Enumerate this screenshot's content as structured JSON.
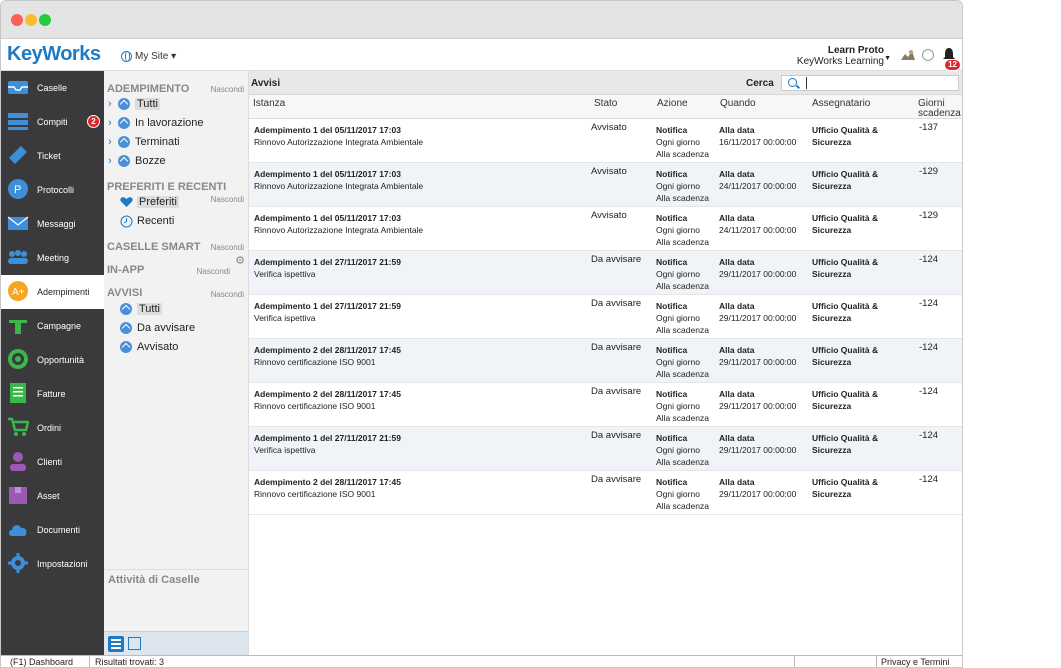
{
  "header": {
    "logo": "KeyWorks",
    "site_label": "My Site ▾",
    "user_name": "Learn Proto",
    "user_org": "KeyWorks Learning",
    "notifications_count": "12"
  },
  "sidebar": {
    "items": [
      {
        "label": "Caselle",
        "icon": "inbox-icon",
        "color": "#3c8fd8"
      },
      {
        "label": "Compiti",
        "icon": "tasks-icon",
        "color": "#3c8fd8",
        "badge": "2"
      },
      {
        "label": "Ticket",
        "icon": "ticket-icon",
        "color": "#3c8fd8"
      },
      {
        "label": "Protocolli",
        "icon": "protocol-icon",
        "color": "#3c8fd8"
      },
      {
        "label": "Messaggi",
        "icon": "envelope-icon",
        "color": "#3c8fd8"
      },
      {
        "label": "Meeting",
        "icon": "people-icon",
        "color": "#3c8fd8"
      },
      {
        "label": "Adempimenti",
        "icon": "compliance-icon",
        "color": "#f5a623"
      },
      {
        "label": "Campagne",
        "icon": "campaign-icon",
        "color": "#3cb54a"
      },
      {
        "label": "Opportunità",
        "icon": "target-icon",
        "color": "#3cb54a"
      },
      {
        "label": "Fatture",
        "icon": "invoice-icon",
        "color": "#3cb54a"
      },
      {
        "label": "Ordini",
        "icon": "cart-icon",
        "color": "#3cb54a"
      },
      {
        "label": "Clienti",
        "icon": "person-icon",
        "color": "#9b59b6"
      },
      {
        "label": "Asset",
        "icon": "box-icon",
        "color": "#9b59b6"
      },
      {
        "label": "Documenti",
        "icon": "cloud-icon",
        "color": "#3c8fd8"
      },
      {
        "label": "Impostazioni",
        "icon": "gear-icon",
        "color": "#3c8fd8"
      }
    ]
  },
  "panel": {
    "hide_label": "Nascondi",
    "sec_adempimento": "ADEMPIMENTO",
    "adempimento_items": [
      "Tutti",
      "In lavorazione",
      "Terminati",
      "Bozze"
    ],
    "sec_preferiti": "PREFERITI E RECENTI",
    "preferiti_items": [
      "Preferiti",
      "Recenti"
    ],
    "sec_caselle_smart": "CASELLE SMART",
    "sec_inapp": "IN-APP",
    "sec_avvisi": "AVVISI",
    "avvisi_items": [
      "Tutti",
      "Da avvisare",
      "Avvisato"
    ],
    "footer_title": "Attività di Caselle"
  },
  "main": {
    "title": "Avvisi",
    "search_label": "Cerca",
    "search_value": "",
    "columns": {
      "istanza": "Istanza",
      "stato": "Stato",
      "azione": "Azione",
      "quando": "Quando",
      "assegnatario": "Assegnatario",
      "giorni": "Giorni scadenza"
    },
    "rows": [
      {
        "title": "Adempimento 1 del 05/11/2017 17:03",
        "desc": "Rinnovo Autorizzazione Integrata Ambientale",
        "stato": "Avvisato",
        "azione1": "Notifica",
        "azione2": "Ogni giorno",
        "azione3": "Alla scadenza",
        "quando1": "Alla data",
        "quando2": "16/11/2017 00:00:00",
        "ass": "Ufficio Qualità & Sicurezza",
        "giorni": "-137"
      },
      {
        "title": "Adempimento 1 del 05/11/2017 17:03",
        "desc": "Rinnovo Autorizzazione Integrata Ambientale",
        "stato": "Avvisato",
        "azione1": "Notifica",
        "azione2": "Ogni giorno",
        "azione3": "Alla scadenza",
        "quando1": "Alla data",
        "quando2": "24/11/2017 00:00:00",
        "ass": "Ufficio Qualità & Sicurezza",
        "giorni": "-129"
      },
      {
        "title": "Adempimento 1 del 05/11/2017 17:03",
        "desc": "Rinnovo Autorizzazione Integrata Ambientale",
        "stato": "Avvisato",
        "azione1": "Notifica",
        "azione2": "Ogni giorno",
        "azione3": "Alla scadenza",
        "quando1": "Alla data",
        "quando2": "24/11/2017 00:00:00",
        "ass": "Ufficio Qualità & Sicurezza",
        "giorni": "-129"
      },
      {
        "title": "Adempimento 1 del 27/11/2017 21:59",
        "desc": "Verifica ispettiva",
        "stato": "Da avvisare",
        "azione1": "Notifica",
        "azione2": "Ogni giorno",
        "azione3": "Alla scadenza",
        "quando1": "Alla data",
        "quando2": "29/11/2017 00:00:00",
        "ass": "Ufficio Qualità & Sicurezza",
        "giorni": "-124"
      },
      {
        "title": "Adempimento 1 del 27/11/2017 21:59",
        "desc": "Verifica ispettiva",
        "stato": "Da avvisare",
        "azione1": "Notifica",
        "azione2": "Ogni giorno",
        "azione3": "Alla scadenza",
        "quando1": "Alla data",
        "quando2": "29/11/2017 00:00:00",
        "ass": "Ufficio Qualità & Sicurezza",
        "giorni": "-124"
      },
      {
        "title": "Adempimento 2 del 28/11/2017 17:45",
        "desc": "Rinnovo certificazione ISO 9001",
        "stato": "Da avvisare",
        "azione1": "Notifica",
        "azione2": "Ogni giorno",
        "azione3": "Alla scadenza",
        "quando1": "Alla data",
        "quando2": "29/11/2017 00:00:00",
        "ass": "Ufficio Qualità & Sicurezza",
        "giorni": "-124"
      },
      {
        "title": "Adempimento 2 del 28/11/2017 17:45",
        "desc": "Rinnovo certificazione ISO 9001",
        "stato": "Da avvisare",
        "azione1": "Notifica",
        "azione2": "Ogni giorno",
        "azione3": "Alla scadenza",
        "quando1": "Alla data",
        "quando2": "29/11/2017 00:00:00",
        "ass": "Ufficio Qualità & Sicurezza",
        "giorni": "-124"
      },
      {
        "title": "Adempimento 1 del 27/11/2017 21:59",
        "desc": "Verifica ispettiva",
        "stato": "Da avvisare",
        "azione1": "Notifica",
        "azione2": "Ogni giorno",
        "azione3": "Alla scadenza",
        "quando1": "Alla data",
        "quando2": "29/11/2017 00:00:00",
        "ass": "Ufficio Qualità & Sicurezza",
        "giorni": "-124"
      },
      {
        "title": "Adempimento 2 del 28/11/2017 17:45",
        "desc": "Rinnovo certificazione ISO 9001",
        "stato": "Da avvisare",
        "azione1": "Notifica",
        "azione2": "Ogni giorno",
        "azione3": "Alla scadenza",
        "quando1": "Alla data",
        "quando2": "29/11/2017 00:00:00",
        "ass": "Ufficio Qualità & Sicurezza",
        "giorni": "-124"
      }
    ]
  },
  "statusbar": {
    "dashboard": "(F1) Dashboard",
    "results": "Risultati trovati: 3",
    "privacy": "Privacy e Termini"
  }
}
